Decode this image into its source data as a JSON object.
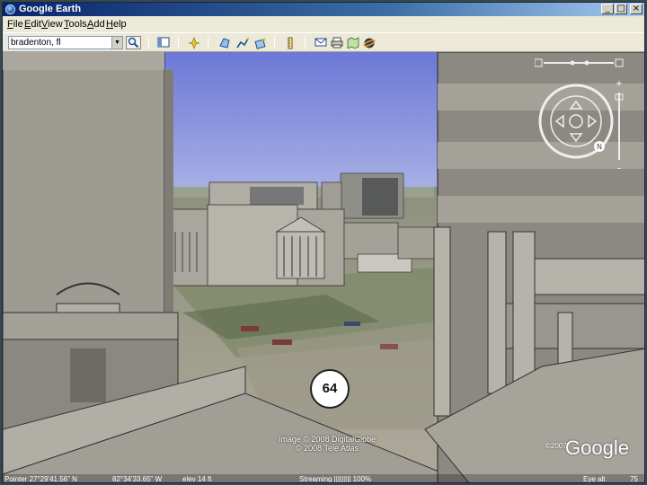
{
  "window": {
    "title": "Google Earth"
  },
  "window_controls": {
    "minimize": "_",
    "maximize": "□",
    "close": "×"
  },
  "menu": [
    {
      "label": "File",
      "u": "F",
      "rest": "ile"
    },
    {
      "label": "Edit",
      "u": "E",
      "rest": "dit"
    },
    {
      "label": "View",
      "u": "V",
      "rest": "iew"
    },
    {
      "label": "Tools",
      "u": "T",
      "rest": "ools"
    },
    {
      "label": "Add",
      "u": "A",
      "rest": "dd"
    },
    {
      "label": "Help",
      "u": "H",
      "rest": "elp"
    }
  ],
  "search": {
    "value": "bradenton, fl"
  },
  "toolbar_icons": [
    "search-go-icon",
    "sidebar-toggle-icon",
    "placemark-icon",
    "polygon-icon",
    "path-icon",
    "overlay-icon",
    "ruler-icon",
    "email-icon",
    "print-icon",
    "maps-icon",
    "sky-icon"
  ],
  "map": {
    "road_shield": "64",
    "credits_line1": "Image © 2008 DigitalGlobe",
    "credits_line2": "© 2008 Tele Atlas",
    "logo_copy": "©2007",
    "logo_text": "Google",
    "nav_north": "N"
  },
  "status": {
    "pointer": "Pointer  27°29'41.56\" N",
    "lon": "82°34'33.65\" W",
    "elev": "elev   14 ft",
    "streaming": "Streaming ||||||||| 100%",
    "eye": "Eye alt",
    "eye_value": "75"
  },
  "colors": {
    "sky": "#7a8ad8",
    "building": "#a29f97",
    "titlebar": "#0a246a"
  }
}
